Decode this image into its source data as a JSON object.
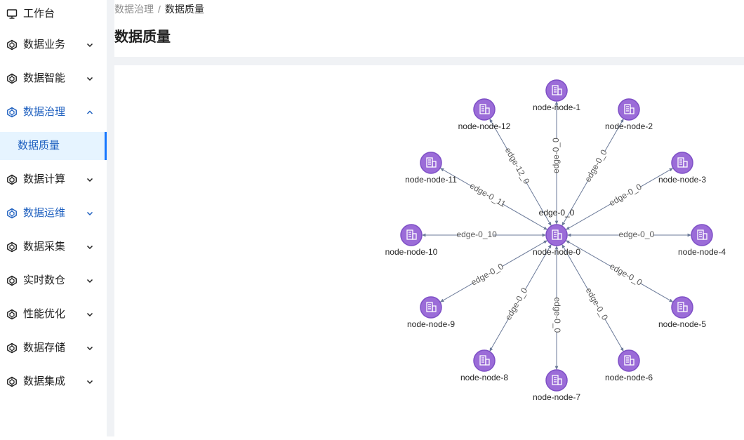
{
  "sidebar": {
    "items": [
      {
        "label": "工作台",
        "icon": "monitor-icon",
        "chevron": ""
      },
      {
        "label": "数据业务",
        "icon": "hexagon-icon",
        "chevron": "down"
      },
      {
        "label": "数据智能",
        "icon": "hexagon-icon",
        "chevron": "down"
      },
      {
        "label": "数据治理",
        "icon": "hexagon-icon",
        "chevron": "up",
        "active": true
      },
      {
        "label": "数据计算",
        "icon": "hexagon-icon",
        "chevron": "down"
      },
      {
        "label": "数据运维",
        "icon": "hexagon-icon",
        "chevron": "down",
        "active": true
      },
      {
        "label": "数据采集",
        "icon": "hexagon-icon",
        "chevron": "down"
      },
      {
        "label": "实时数仓",
        "icon": "hexagon-icon",
        "chevron": "down"
      },
      {
        "label": "性能优化",
        "icon": "hexagon-icon",
        "chevron": "down"
      },
      {
        "label": "数据存储",
        "icon": "hexagon-icon",
        "chevron": "down"
      },
      {
        "label": "数据集成",
        "icon": "hexagon-icon",
        "chevron": "down"
      }
    ],
    "selected_sub": "数据质量"
  },
  "breadcrumb": {
    "parent": "数据治理",
    "separator": "/",
    "current": "数据质量"
  },
  "page_title": "数据质量",
  "colors": {
    "accent": "#1677ff",
    "active_text": "#1d5fbf",
    "node": "#9b6cd8",
    "node_stroke": "#7e4fc6",
    "edge": "#6b7a99"
  },
  "graph": {
    "center": "node-node-0",
    "nodes": [
      {
        "id": "node-node-0"
      },
      {
        "id": "node-node-1"
      },
      {
        "id": "node-node-2"
      },
      {
        "id": "node-node-3"
      },
      {
        "id": "node-node-4"
      },
      {
        "id": "node-node-5"
      },
      {
        "id": "node-node-6"
      },
      {
        "id": "node-node-7"
      },
      {
        "id": "node-node-8"
      },
      {
        "id": "node-node-9"
      },
      {
        "id": "node-node-10"
      },
      {
        "id": "node-node-11"
      },
      {
        "id": "node-node-12"
      }
    ],
    "edges": [
      {
        "target": "node-node-1",
        "label": "edge-0_0"
      },
      {
        "target": "node-node-2",
        "label": "edge-0_0"
      },
      {
        "target": "node-node-3",
        "label": "edge-0_0"
      },
      {
        "target": "node-node-4",
        "label": "edge-0_0"
      },
      {
        "target": "node-node-5",
        "label": "edge-0_0"
      },
      {
        "target": "node-node-6",
        "label": "edge-0_0"
      },
      {
        "target": "node-node-7",
        "label": "edge-0_0"
      },
      {
        "target": "node-node-8",
        "label": "edge-0_0"
      },
      {
        "target": "node-node-9",
        "label": "edge-0_0"
      },
      {
        "target": "node-node-10",
        "label": "edge-0_10"
      },
      {
        "target": "node-node-11",
        "label": "edge-0_11"
      },
      {
        "target": "node-node-12",
        "label": "edge-12_0"
      }
    ],
    "top_edge_label": "edge-0_0"
  }
}
